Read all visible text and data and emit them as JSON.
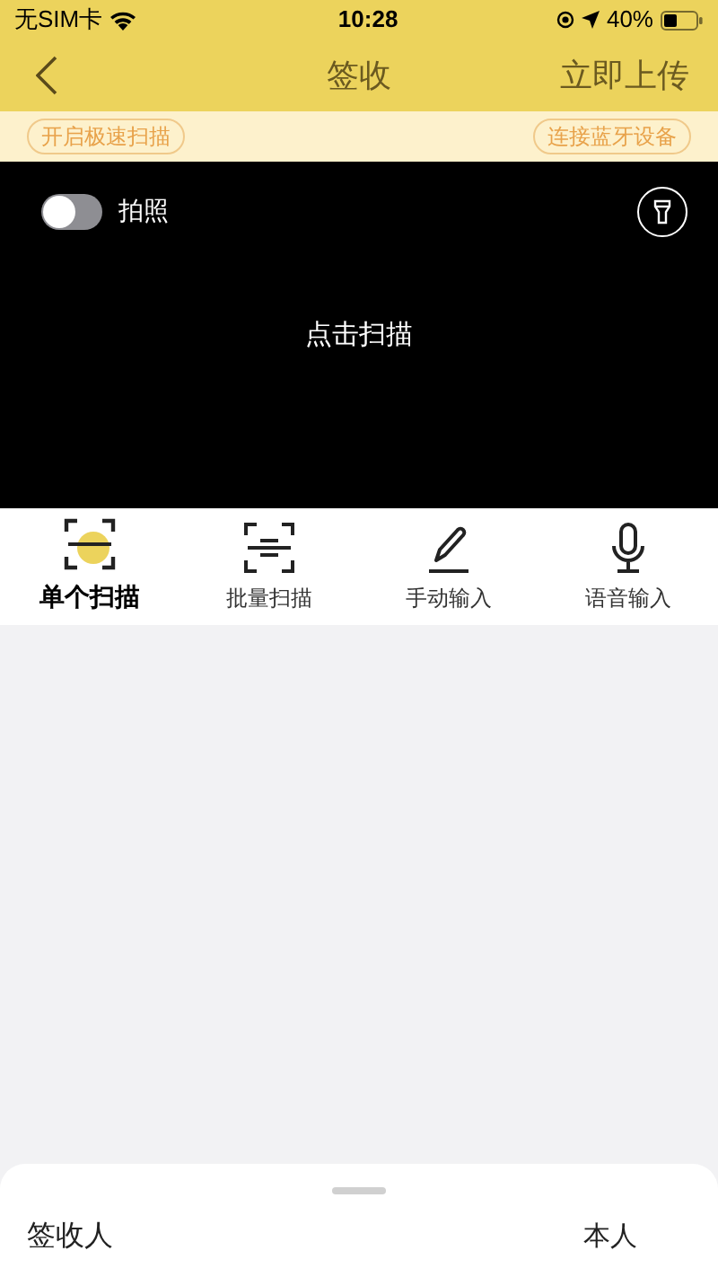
{
  "status_bar": {
    "carrier": "无SIM卡",
    "time": "10:28",
    "battery": "40%"
  },
  "nav": {
    "title": "签收",
    "action": "立即上传"
  },
  "toolbar": {
    "left": "开启极速扫描",
    "right": "连接蓝牙设备"
  },
  "camera": {
    "photo_toggle": {
      "label": "拍照",
      "on": false
    },
    "prompt": "点击扫描"
  },
  "modes": [
    {
      "kind": "single",
      "label": "单个扫描",
      "selected": true
    },
    {
      "kind": "batch",
      "label": "批量扫描",
      "selected": false
    },
    {
      "kind": "manual",
      "label": "手动输入",
      "selected": false
    },
    {
      "kind": "voice",
      "label": "语音输入",
      "selected": false
    }
  ],
  "sheet": {
    "label": "签收人",
    "value": "本人"
  }
}
